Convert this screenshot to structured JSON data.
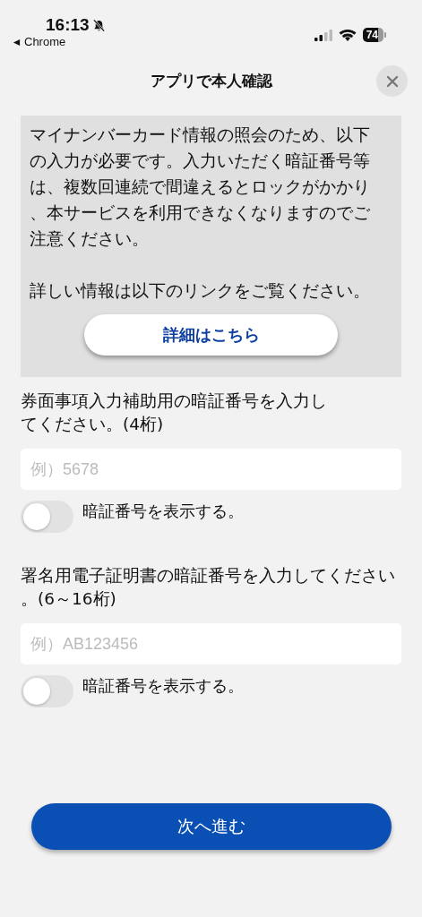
{
  "status_bar": {
    "time": "16:13",
    "back_app": "Chrome",
    "battery": "74"
  },
  "header": {
    "title": "アプリで本人確認"
  },
  "notice": {
    "paragraphs": [
      "マイナンバーカード情報の照会のため、以下の入力が必要です。入力いただく暗証番号等は、複数回連続で間違えるとロックがかかり、本サービスを利用できなくなりますのでご注意ください。",
      "詳しい情報は以下のリンクをご覧ください。"
    ],
    "button": "詳細はこちら"
  },
  "fields": [
    {
      "label": "券面事項入力補助用の暗証番号を入力してください。(4桁)",
      "placeholder": "例）5678",
      "toggle": {
        "label": "暗証番号を表示する。",
        "on": false
      }
    },
    {
      "label": "署名用電子証明書の暗証番号を入力してください。(6～16桁)",
      "placeholder": "例）AB123456",
      "toggle": {
        "label": "暗証番号を表示する。",
        "on": false
      }
    }
  ],
  "next_button": "次へ進む"
}
